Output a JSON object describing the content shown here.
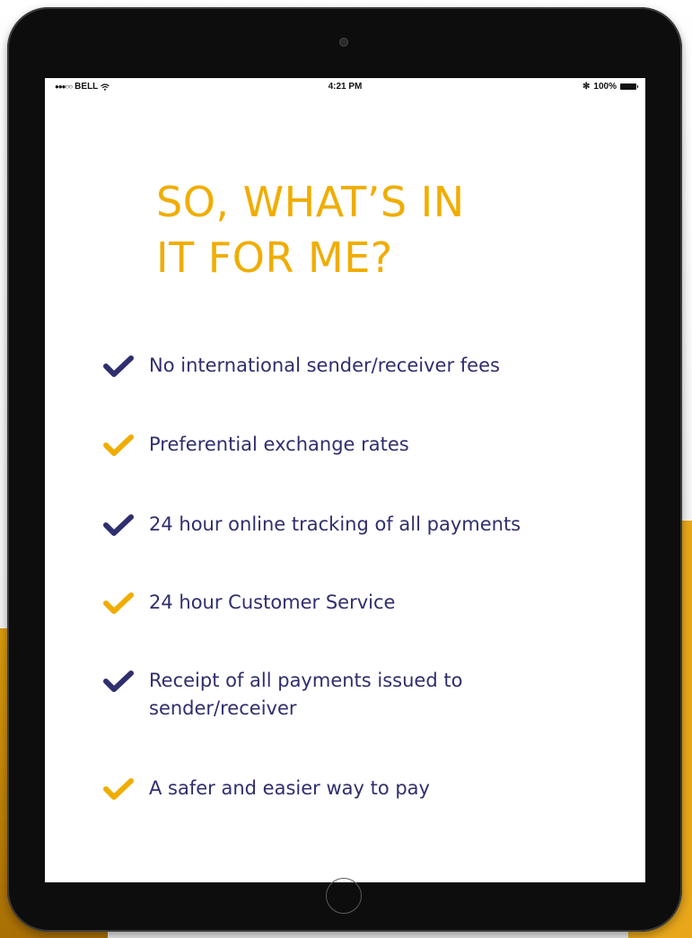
{
  "status_bar": {
    "carrier": "BELL",
    "signal_dots": "●●●○○",
    "time": "4:21 PM",
    "bluetooth": "✻",
    "battery_percent": "100%"
  },
  "headline": {
    "line1": "SO, WHAT’S IN",
    "line2": "IT FOR ME?"
  },
  "features": [
    {
      "text": "No international sender/receiver fees",
      "check_color": "#2f2e6e"
    },
    {
      "text": "Preferential exchange rates",
      "check_color": "#f0ad00"
    },
    {
      "text": "24 hour online tracking of all payments",
      "check_color": "#2f2e6e"
    },
    {
      "text": "24 hour Customer Service",
      "check_color": "#f0ad00"
    },
    {
      "text": "Receipt of all payments issued to sender/receiver",
      "check_color": "#2f2e6e"
    },
    {
      "text": "A safer and easier way to pay",
      "check_color": "#f0ad00"
    }
  ],
  "colors": {
    "headline": "#f0ad00",
    "text": "#2f2e6e",
    "navy_check": "#2f2e6e",
    "gold_check": "#f0ad00",
    "tablet_frame": "#0d0d0d",
    "accent_background": "#e8a71a"
  },
  "icons": {
    "check": "check-icon",
    "wifi": "wifi-icon",
    "bluetooth": "bluetooth-icon",
    "battery": "battery-icon"
  }
}
